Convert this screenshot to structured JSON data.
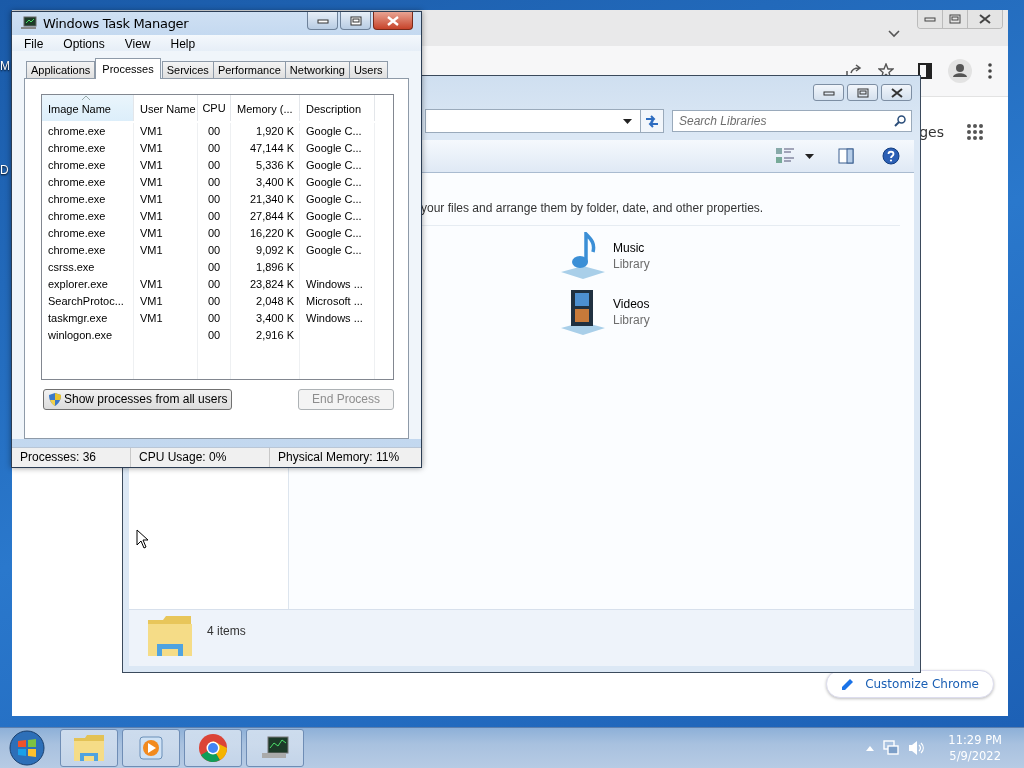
{
  "desktop": {
    "icon_labels": [
      "M",
      "D"
    ]
  },
  "chrome": {
    "partial_link": "ges",
    "customize_button": "Customize Chrome"
  },
  "explorer": {
    "search": {
      "placeholder": "Search Libraries"
    },
    "description": "your files and arrange them by folder, date, and other properties.",
    "libraries": [
      {
        "name": "Music",
        "type": "Library",
        "kind": "music"
      },
      {
        "name": "Videos",
        "type": "Library",
        "kind": "videos"
      }
    ],
    "status": "4 items"
  },
  "task_manager": {
    "title": "Windows Task Manager",
    "menu": [
      "File",
      "Options",
      "View",
      "Help"
    ],
    "tabs": [
      {
        "label": "Applications",
        "selected": false
      },
      {
        "label": "Processes",
        "selected": true
      },
      {
        "label": "Services",
        "selected": false
      },
      {
        "label": "Performance",
        "selected": false
      },
      {
        "label": "Networking",
        "selected": false
      },
      {
        "label": "Users",
        "selected": false
      }
    ],
    "table": {
      "columns": [
        {
          "label": "Image Name",
          "sorted": true
        },
        {
          "label": "User Name",
          "sorted": false
        },
        {
          "label": "CPU",
          "sorted": false
        },
        {
          "label": "Memory (...",
          "sorted": false
        },
        {
          "label": "Description",
          "sorted": false
        }
      ],
      "rows": [
        [
          "chrome.exe",
          "VM1",
          "00",
          "1,920 K",
          "Google C..."
        ],
        [
          "chrome.exe",
          "VM1",
          "00",
          "47,144 K",
          "Google C..."
        ],
        [
          "chrome.exe",
          "VM1",
          "00",
          "5,336 K",
          "Google C..."
        ],
        [
          "chrome.exe",
          "VM1",
          "00",
          "3,400 K",
          "Google C..."
        ],
        [
          "chrome.exe",
          "VM1",
          "00",
          "21,340 K",
          "Google C..."
        ],
        [
          "chrome.exe",
          "VM1",
          "00",
          "27,844 K",
          "Google C..."
        ],
        [
          "chrome.exe",
          "VM1",
          "00",
          "16,220 K",
          "Google C..."
        ],
        [
          "chrome.exe",
          "VM1",
          "00",
          "9,092 K",
          "Google C..."
        ],
        [
          "csrss.exe",
          null,
          "00",
          "1,896 K",
          null
        ],
        [
          "explorer.exe",
          "VM1",
          "00",
          "23,824 K",
          "Windows ..."
        ],
        [
          "SearchProtoc...",
          "VM1",
          "00",
          "2,048 K",
          "Microsoft ..."
        ],
        [
          "taskmgr.exe",
          "VM1",
          "00",
          "3,400 K",
          "Windows ..."
        ],
        [
          "winlogon.exe",
          null,
          "00",
          "2,916 K",
          null
        ]
      ]
    },
    "buttons": [
      {
        "label": "Show processes from all users",
        "disabled": false,
        "kind": "shield"
      },
      {
        "label": "End Process",
        "disabled": true,
        "kind": "plain"
      }
    ],
    "status_bar": [
      "Processes: 36",
      "CPU Usage: 0%",
      "Physical Memory: 11%"
    ]
  },
  "taskbar": {
    "apps": [
      {
        "kind": "explorer"
      },
      {
        "kind": "media"
      },
      {
        "kind": "chrome"
      },
      {
        "kind": "taskmgr"
      }
    ],
    "time": "11:29 PM",
    "date": "5/9/2022"
  }
}
